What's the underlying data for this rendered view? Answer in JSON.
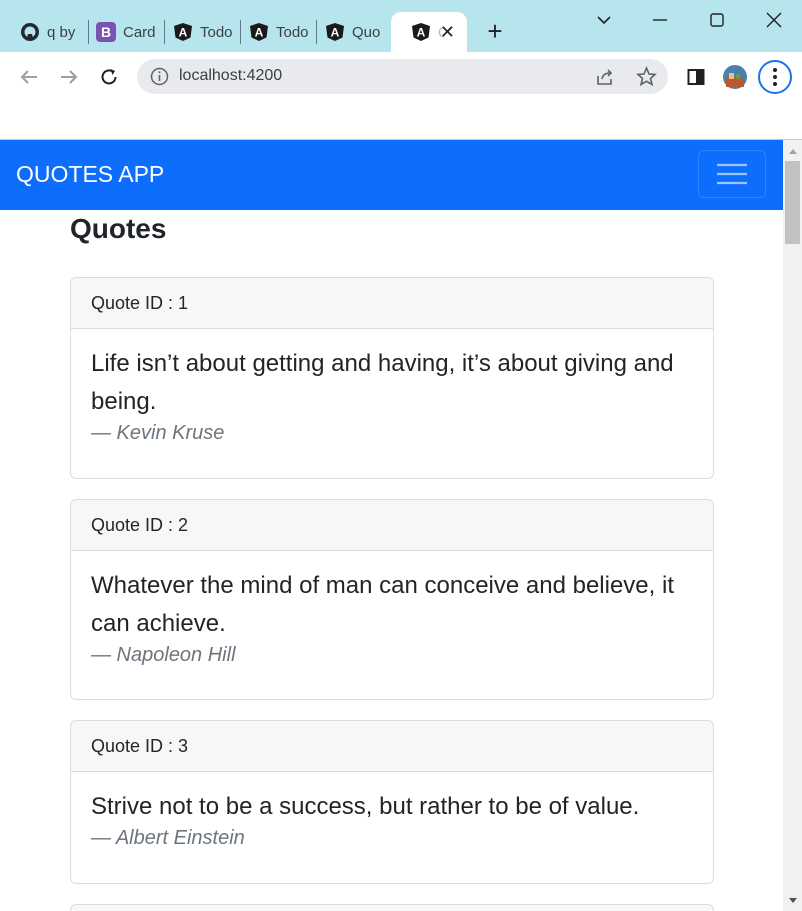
{
  "browser": {
    "tabs": [
      {
        "title": "q by",
        "icon": "github-icon"
      },
      {
        "title": "Card",
        "icon": "bootstrap-icon"
      },
      {
        "title": "Todo",
        "icon": "angular-icon"
      },
      {
        "title": "Todo",
        "icon": "angular-icon"
      },
      {
        "title": "Quo",
        "icon": "angular-icon"
      },
      {
        "title": "Q",
        "icon": "angular-icon",
        "active": true
      }
    ],
    "address": "localhost:4200"
  },
  "app": {
    "brand": "QUOTES APP",
    "page_title": "Quotes",
    "quotes": [
      {
        "header": "Quote ID : 1",
        "text": "Life isn’t about getting and having, it’s about giving and being.",
        "author": "— Kevin Kruse"
      },
      {
        "header": "Quote ID : 2",
        "text": "Whatever the mind of man can conceive and believe, it can achieve.",
        "author": "— Napoleon Hill"
      },
      {
        "header": "Quote ID : 3",
        "text": "Strive not to be a success, but rather to be of value.",
        "author": "— Albert Einstein"
      }
    ]
  },
  "colors": {
    "navbar": "#0d6efd",
    "tabstrip": "#b6e5ee",
    "author": "#6c757d"
  }
}
